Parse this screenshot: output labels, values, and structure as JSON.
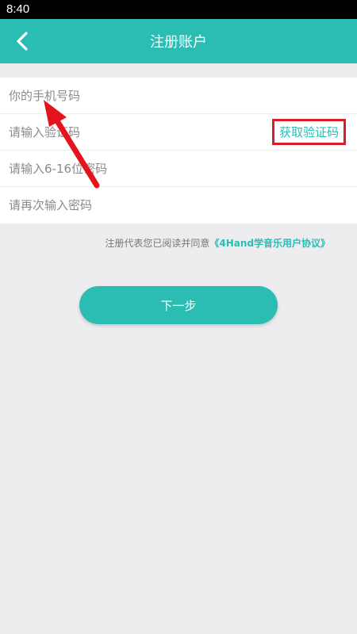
{
  "status_bar": {
    "time": "8:40"
  },
  "header": {
    "title": "注册账户",
    "back_icon": "chevron-left-icon"
  },
  "form": {
    "phone_placeholder": "你的手机号码",
    "code_placeholder": "请输入验证码",
    "get_code_label": "获取验证码",
    "password_placeholder": "请输入6-16位密码",
    "confirm_password_placeholder": "请再次输入密码"
  },
  "agreement": {
    "prefix": "注册代表您已阅读并同意",
    "link": "《4Hand学音乐用户协议》"
  },
  "next_button_label": "下一步",
  "annotation": {
    "arrow_icon": "red-arrow-icon",
    "arrow_color": "#e3141e"
  },
  "colors": {
    "accent": "#2bbcb4",
    "highlight_border": "#d9202a"
  }
}
